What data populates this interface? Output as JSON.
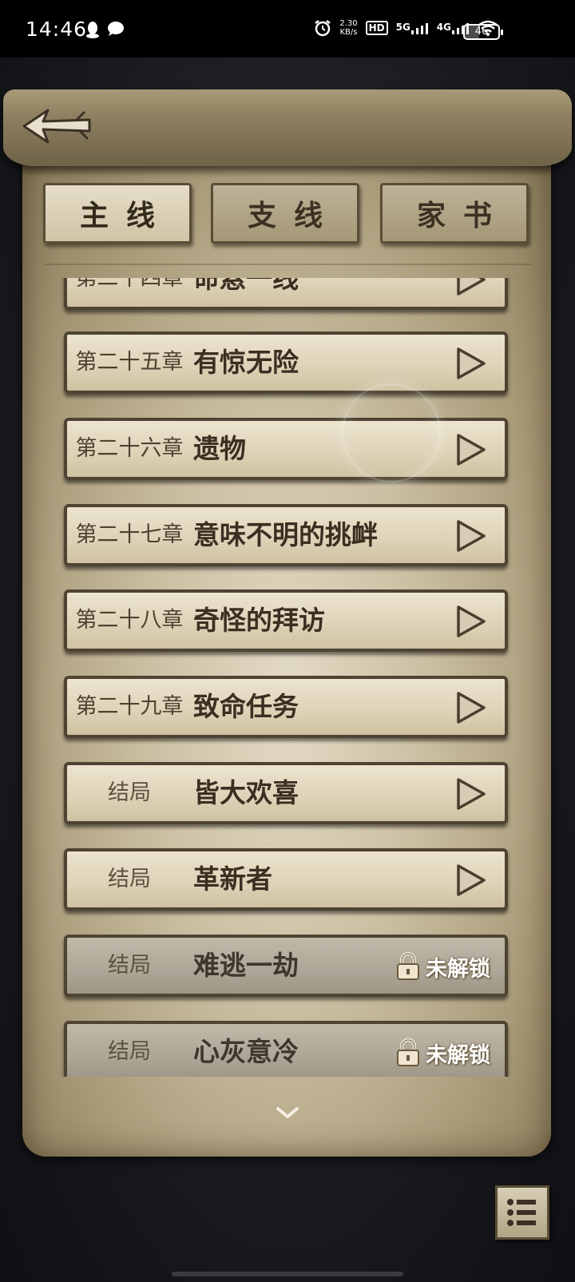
{
  "status_bar": {
    "time": "14:46",
    "speed_value": "2.30",
    "speed_unit": "KB/s",
    "hd_label": "HD",
    "net1": "5G",
    "net2": "4G",
    "battery": "46",
    "icons": [
      "qq-icon",
      "message-icon",
      "alarm-icon",
      "hd-icon",
      "signal-5g-icon",
      "signal-4g-icon",
      "wifi-icon",
      "battery-icon"
    ]
  },
  "header": {
    "back_icon": "arrow-back-icon"
  },
  "tabs": [
    {
      "label": "主线",
      "active": true
    },
    {
      "label": "支线",
      "active": false
    },
    {
      "label": "家书",
      "active": false
    }
  ],
  "chapters": [
    {
      "number": "第二十四章",
      "title": "命悬一线",
      "locked": false
    },
    {
      "number": "第二十五章",
      "title": "有惊无险",
      "locked": false
    },
    {
      "number": "第二十六章",
      "title": "遗物",
      "locked": false
    },
    {
      "number": "第二十七章",
      "title": "意味不明的挑衅",
      "locked": false
    },
    {
      "number": "第二十八章",
      "title": "奇怪的拜访",
      "locked": false
    },
    {
      "number": "第二十九章",
      "title": "致命任务",
      "locked": false
    },
    {
      "number": "结局",
      "title": "皆大欢喜",
      "locked": false
    },
    {
      "number": "结局",
      "title": "革新者",
      "locked": false
    },
    {
      "number": "结局",
      "title": "难逃一劫",
      "locked": true
    },
    {
      "number": "结局",
      "title": "心灰意冷",
      "locked": true
    }
  ],
  "locked_label": "未解锁",
  "footer": {
    "more_icon": "chevron-down-icon",
    "menu_icon": "list-menu-icon"
  }
}
